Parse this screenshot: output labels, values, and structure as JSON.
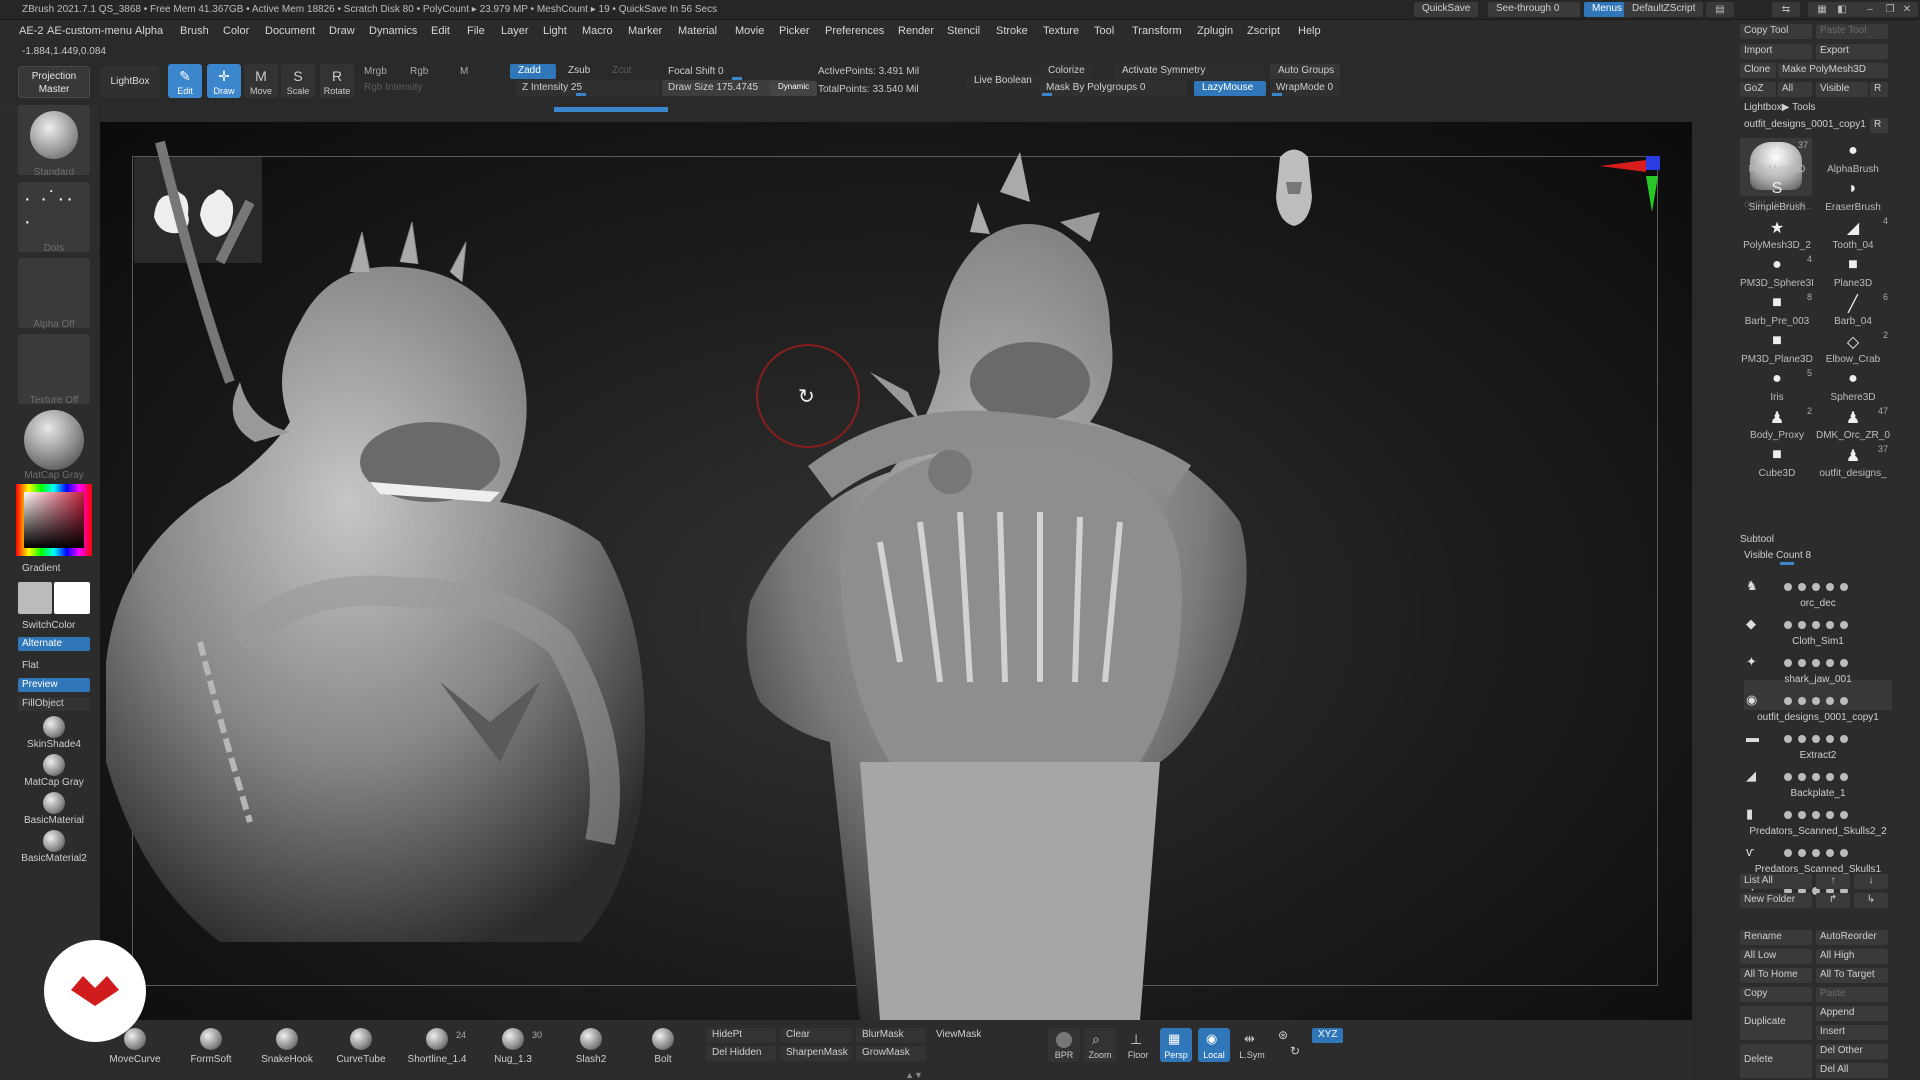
{
  "titlebar": {
    "title": "ZBrush 2021.7.1   QS_3868   • Free Mem 41.367GB • Active Mem 18826 • Scratch Disk 80 • PolyCount ▸ 23.979 MP  • MeshCount ▸ 19  • QuickSave In 56 Secs",
    "quicksave": "QuickSave",
    "seethrough": "See-through  0",
    "menus": "Menus",
    "defaultzscript": "DefaultZScript"
  },
  "menubar": [
    "AE-2",
    "AE-custom-menu",
    "Alpha",
    "Brush",
    "Color",
    "Document",
    "Draw",
    "Dynamics",
    "Edit",
    "File",
    "Layer",
    "Light",
    "Macro",
    "Marker",
    "Material",
    "Movie",
    "Picker",
    "Preferences",
    "Render",
    "Stencil",
    "Stroke",
    "Texture",
    "Tool",
    "Transform",
    "Zplugin",
    "Zscript",
    "Help"
  ],
  "coords": "-1.884,1.449,0.084",
  "shelf": {
    "projection_master": "Projection Master",
    "lightbox": "LightBox",
    "edit": "Edit",
    "draw": "Draw",
    "move": "Move",
    "scale": "Scale",
    "rotate": "Rotate",
    "mrgb": "Mrgb",
    "rgb": "Rgb",
    "m": "M",
    "rgb_intensity": "Rgb Intensity",
    "zadd": "Zadd",
    "zsub": "Zsub",
    "zcut": "Zcut",
    "z_intensity": "Z Intensity 25",
    "focal_shift": "Focal Shift  0",
    "draw_size": "Draw Size  175.4745",
    "dynamic": "Dynamic",
    "active_points": "ActivePoints: 3.491 Mil",
    "total_points": "TotalPoints: 33.540 Mil",
    "live_boolean": "Live Boolean",
    "colorize": "Colorize",
    "activate_symmetry": "Activate Symmetry",
    "mask_by_polygroups": "Mask By Polygroups  0",
    "lazymouse": "LazyMouse",
    "auto_groups": "Auto Groups",
    "wrapmode": "WrapMode  0"
  },
  "left": {
    "standard": "Standard",
    "dots": "Dots",
    "alpha_off": "Alpha Off",
    "texture_off": "Texture Off",
    "matcap_gray": "MatCap Gray",
    "gradient": "Gradient",
    "switchcolor": "SwitchColor",
    "alternate": "Alternate",
    "flat": "Flat",
    "preview": "Preview",
    "fillobject": "FillObject",
    "materials": [
      "SkinShade4",
      "MatCap Gray",
      "BasicMaterial",
      "BasicMaterial2"
    ]
  },
  "right": {
    "copy_tool": "Copy Tool",
    "paste_tool": "Paste Tool",
    "import": "Import",
    "export": "Export",
    "clone": "Clone",
    "make_polymesh": "Make PolyMesh3D",
    "goz": "GoZ",
    "all": "All",
    "visible": "Visible",
    "r": "R",
    "lightbox_tools": "Lightbox▶ Tools",
    "current_tool": "outfit_designs_0001_copy1",
    "current_tool_short": "outfit_designs_",
    "current_tool_count": "37",
    "tools": [
      {
        "label": "PolyMesh3D",
        "glyph": "★",
        "count": ""
      },
      {
        "label": "AlphaBrush",
        "glyph": "●",
        "count": ""
      },
      {
        "label": "SimpleBrush",
        "glyph": "S",
        "count": ""
      },
      {
        "label": "EraserBrush",
        "glyph": "◗",
        "count": ""
      },
      {
        "label": "PolyMesh3D_2",
        "glyph": "★",
        "count": ""
      },
      {
        "label": "Tooth_04",
        "glyph": "◢",
        "count": "4"
      },
      {
        "label": "PM3D_Sphere3I",
        "glyph": "●",
        "count": "4"
      },
      {
        "label": "Plane3D",
        "glyph": "■",
        "count": ""
      },
      {
        "label": "Barb_Pre_003",
        "glyph": "■",
        "count": "8"
      },
      {
        "label": "Barb_04",
        "glyph": "╱",
        "count": "6"
      },
      {
        "label": "PM3D_Plane3D",
        "glyph": "■",
        "count": ""
      },
      {
        "label": "Elbow_Crab",
        "glyph": "◇",
        "count": "2"
      },
      {
        "label": "Iris",
        "glyph": "●",
        "count": "5"
      },
      {
        "label": "Sphere3D",
        "glyph": "●",
        "count": ""
      },
      {
        "label": "Body_Proxy",
        "glyph": "♟",
        "count": "2"
      },
      {
        "label": "DMK_Orc_ZR_0(",
        "glyph": "♟",
        "count": "47"
      },
      {
        "label": "Cube3D",
        "glyph": "■",
        "count": ""
      },
      {
        "label": "outfit_designs_",
        "glyph": "♟",
        "count": "37"
      }
    ],
    "subtool": "Subtool",
    "visible_count": "Visible Count 8",
    "subtools": [
      "",
      "orc_dec",
      "Cloth_Sim1",
      "shark_jaw_001",
      "outfit_designs_0001_copy1",
      "Extract2",
      "Backplate_1",
      "Predators_Scanned_Skulls2_2",
      "Predators_Scanned_Skulls1"
    ],
    "list_all": "List All",
    "new_folder": "New Folder",
    "rename": "Rename",
    "autoreorder": "AutoReorder",
    "all_low": "All Low",
    "all_high": "All High",
    "all_to_home": "All To Home",
    "all_to_target": "All To Target",
    "copy": "Copy",
    "paste": "Paste",
    "duplicate": "Duplicate",
    "append": "Append",
    "insert": "Insert",
    "delete": "Delete",
    "del_other": "Del Other",
    "del_all": "Del All"
  },
  "bottom": {
    "brushes": [
      {
        "label": "MoveCurve",
        "count": ""
      },
      {
        "label": "FormSoft",
        "count": ""
      },
      {
        "label": "SnakeHook",
        "count": ""
      },
      {
        "label": "CurveTube",
        "count": ""
      },
      {
        "label": "Shortline_1.4",
        "count": "24"
      },
      {
        "label": "Nug_1.3",
        "count": "30"
      },
      {
        "label": "Slash2",
        "count": ""
      },
      {
        "label": "Bolt",
        "count": ""
      }
    ],
    "hidept": "HidePt",
    "clear": "Clear",
    "blurmask": "BlurMask",
    "viewmask": "ViewMask",
    "del_hidden": "Del Hidden",
    "sharpenmask": "SharpenMask",
    "growmask": "GrowMask",
    "bpr": "BPR",
    "zoom": "Zoom",
    "floor": "Floor",
    "persp": "Persp",
    "local": "Local",
    "lsym": "L.Sym",
    "xyz": "XYZ"
  },
  "colors": {
    "accent": "#2f77b8",
    "cursor_ring": "#8a1d1d",
    "logo_red": "#d01c1c",
    "gizmo_x": "#d81d1d",
    "gizmo_y": "#28c828",
    "gizmo_z": "#2a3de0"
  }
}
